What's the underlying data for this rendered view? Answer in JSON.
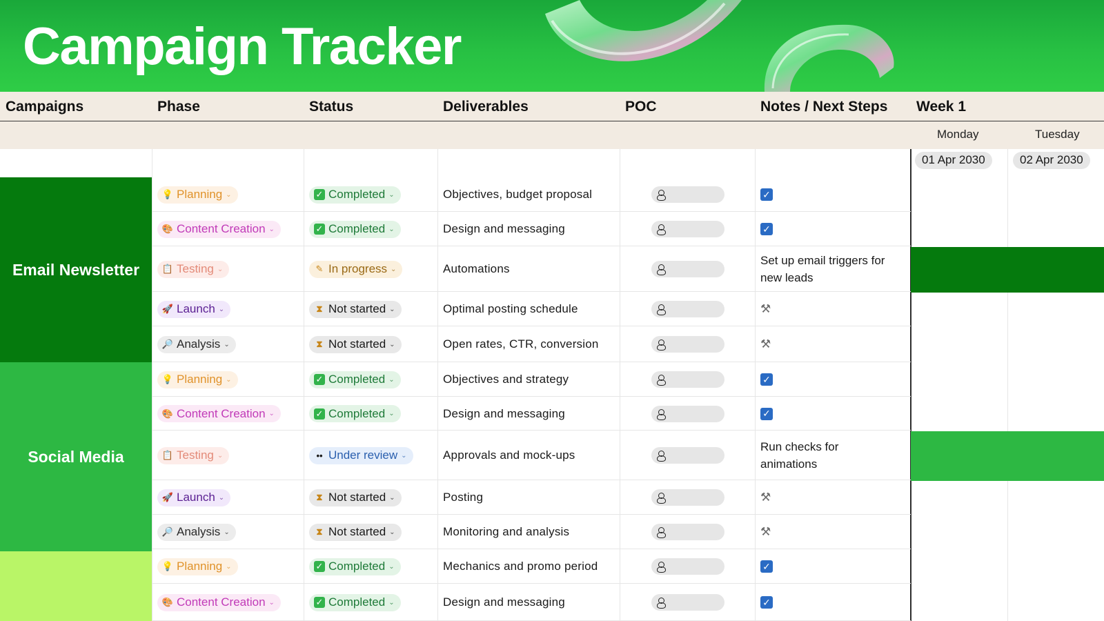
{
  "title": "Campaign Tracker",
  "headers": {
    "campaigns": "Campaigns",
    "phase": "Phase",
    "status": "Status",
    "deliverables": "Deliverables",
    "poc": "POC",
    "notes": "Notes / Next Steps",
    "week": "Week 1"
  },
  "days": [
    {
      "name": "Monday",
      "date": "01 Apr 2030"
    },
    {
      "name": "Tuesday",
      "date": "02 Apr 2030"
    }
  ],
  "campaigns": [
    "Email Newsletter",
    "Social Media"
  ],
  "colors": {
    "email": "#057a0d",
    "social": "#2db843",
    "third": "#b9f567",
    "banner": "#27c043"
  },
  "rows": [
    {
      "phase": "Planning",
      "phase_icon": "lightbulb-icon",
      "status": "Completed",
      "status_icon": "check-mark-icon",
      "deliverable": "Objectives, budget proposal",
      "note": "",
      "note_icon": "checkbox-icon"
    },
    {
      "phase": "Content Creation",
      "phase_icon": "palette-icon",
      "status": "Completed",
      "status_icon": "check-mark-icon",
      "deliverable": "Design and messaging",
      "note": "",
      "note_icon": "checkbox-icon"
    },
    {
      "phase": "Testing",
      "phase_icon": "clipboard-icon",
      "status": "In progress",
      "status_icon": "pencil-icon",
      "deliverable": "Automations",
      "note_l1": "Set up email triggers for",
      "note_l2": "new leads",
      "note_icon": ""
    },
    {
      "phase": "Launch",
      "phase_icon": "rocket-icon",
      "status": "Not started",
      "status_icon": "hourglass-icon",
      "deliverable": "Optimal posting schedule",
      "note": "",
      "note_icon": "tools-icon"
    },
    {
      "phase": "Analysis",
      "phase_icon": "magnifier-icon",
      "status": "Not started",
      "status_icon": "hourglass-icon",
      "deliverable": "Open rates, CTR, conversion",
      "note": "",
      "note_icon": "tools-icon"
    },
    {
      "phase": "Planning",
      "phase_icon": "lightbulb-icon",
      "status": "Completed",
      "status_icon": "check-mark-icon",
      "deliverable": "Objectives and strategy",
      "note": "",
      "note_icon": "checkbox-icon"
    },
    {
      "phase": "Content Creation",
      "phase_icon": "palette-icon",
      "status": "Completed",
      "status_icon": "check-mark-icon",
      "deliverable": "Design and messaging",
      "note": "",
      "note_icon": "checkbox-icon"
    },
    {
      "phase": "Testing",
      "phase_icon": "clipboard-icon",
      "status": "Under review",
      "status_icon": "eyes-icon",
      "deliverable": "Approvals and mock-ups",
      "note_l1": "Run checks for",
      "note_l2": "animations",
      "note_icon": ""
    },
    {
      "phase": "Launch",
      "phase_icon": "rocket-icon",
      "status": "Not started",
      "status_icon": "hourglass-icon",
      "deliverable": "Posting",
      "note": "",
      "note_icon": "tools-icon"
    },
    {
      "phase": "Analysis",
      "phase_icon": "magnifier-icon",
      "status": "Not started",
      "status_icon": "hourglass-icon",
      "deliverable": "Monitoring and analysis",
      "note": "",
      "note_icon": "tools-icon"
    },
    {
      "phase": "Planning",
      "phase_icon": "lightbulb-icon",
      "status": "Completed",
      "status_icon": "check-mark-icon",
      "deliverable": "Mechanics and promo period",
      "note": "",
      "note_icon": "checkbox-icon"
    },
    {
      "phase": "Content Creation",
      "phase_icon": "palette-icon",
      "status": "Completed",
      "status_icon": "check-mark-icon",
      "deliverable": "Design and messaging",
      "note": "",
      "note_icon": "checkbox-icon"
    }
  ]
}
